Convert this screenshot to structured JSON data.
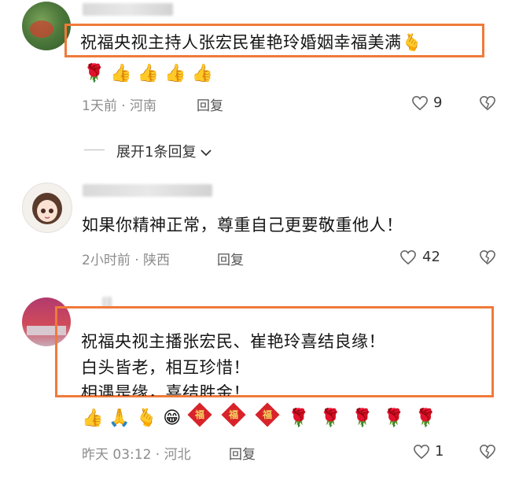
{
  "comments": [
    {
      "text_lines": [
        "祝福央视主持人张宏民崔艳玲婚姻幸福美满"
      ],
      "trail_emoji": "🫰",
      "emoji_row": [
        "🌹",
        "👍",
        "👍",
        "👍",
        "👍"
      ],
      "time": "1天前",
      "location": "河南",
      "reply_label": "回复",
      "likes": "9"
    },
    {
      "text_lines": [
        "如果你精神正常，尊重自己更要敬重他人！"
      ],
      "time": "2小时前",
      "location": "陕西",
      "reply_label": "回复",
      "likes": "42"
    },
    {
      "text_lines": [
        "祝福央视主播张宏民、崔艳玲喜结良缘！",
        "白头皆老，相互珍惜！",
        "相遇是缘，喜结胜金！"
      ],
      "emoji_row": [
        "👍",
        "🙏",
        "🫰",
        "😁",
        "福",
        "福",
        "福",
        "🌹",
        "🌹",
        "🌹",
        "🌹",
        "🌹"
      ],
      "time": "昨天 03:12",
      "location": "河北",
      "reply_label": "回复",
      "likes": "1"
    }
  ],
  "expand_label": "展开1条回复",
  "colors": {
    "highlight": "#f07a3a",
    "meta": "#8c8c8c"
  },
  "icons": {
    "like": "heart-outline-icon",
    "dislike": "broken-heart-icon",
    "expand": "chevron-down-icon"
  }
}
